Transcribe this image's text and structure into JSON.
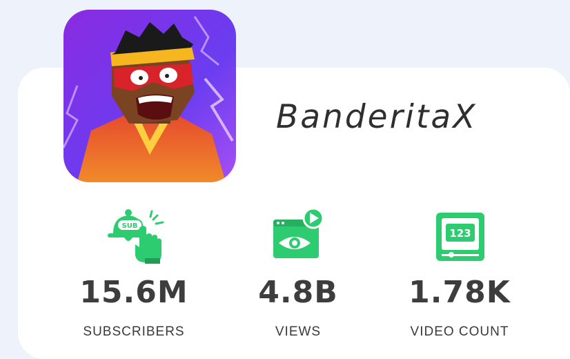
{
  "channel": {
    "name": "BanderitaX",
    "avatar_icon": "cartoon-character-avatar"
  },
  "stats": [
    {
      "value": "15.6M",
      "label": "SUBSCRIBERS",
      "icon": "subscribe-bell-icon"
    },
    {
      "value": "4.8B",
      "label": "VIEWS",
      "icon": "video-views-icon"
    },
    {
      "value": "1.78K",
      "label": "VIDEO COUNT",
      "icon": "video-count-icon"
    }
  ],
  "colors": {
    "background": "#eef2fb",
    "card": "#ffffff",
    "accent_green": "#2ecc71",
    "text_dark": "#3d3d3d"
  }
}
